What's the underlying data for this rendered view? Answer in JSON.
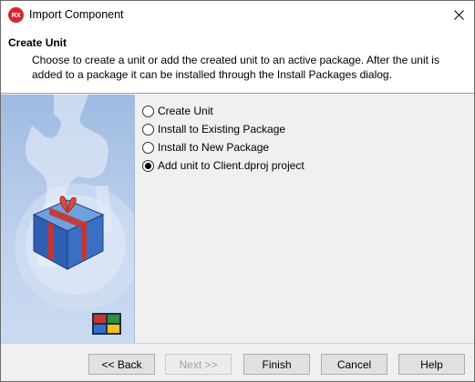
{
  "window": {
    "title": "Import Component",
    "app_icon_text": "RX",
    "close_icon": "close-icon"
  },
  "header": {
    "title": "Create Unit",
    "description": "Choose to create a unit or add the created unit to an active package. After the unit is added to a package it can be installed through the Install Packages dialog."
  },
  "options": [
    {
      "label": "Create Unit",
      "checked": false
    },
    {
      "label": "Install to Existing Package",
      "checked": false
    },
    {
      "label": "Install to New Package",
      "checked": false
    },
    {
      "label": "Add unit to Client.dproj project",
      "checked": true
    }
  ],
  "buttons": {
    "back": "<< Back",
    "next": "Next >>",
    "finish": "Finish",
    "cancel": "Cancel",
    "help": "Help"
  },
  "colors": {
    "accent_red": "#d7262c",
    "side_panel_blue": "#9fbbe2"
  }
}
